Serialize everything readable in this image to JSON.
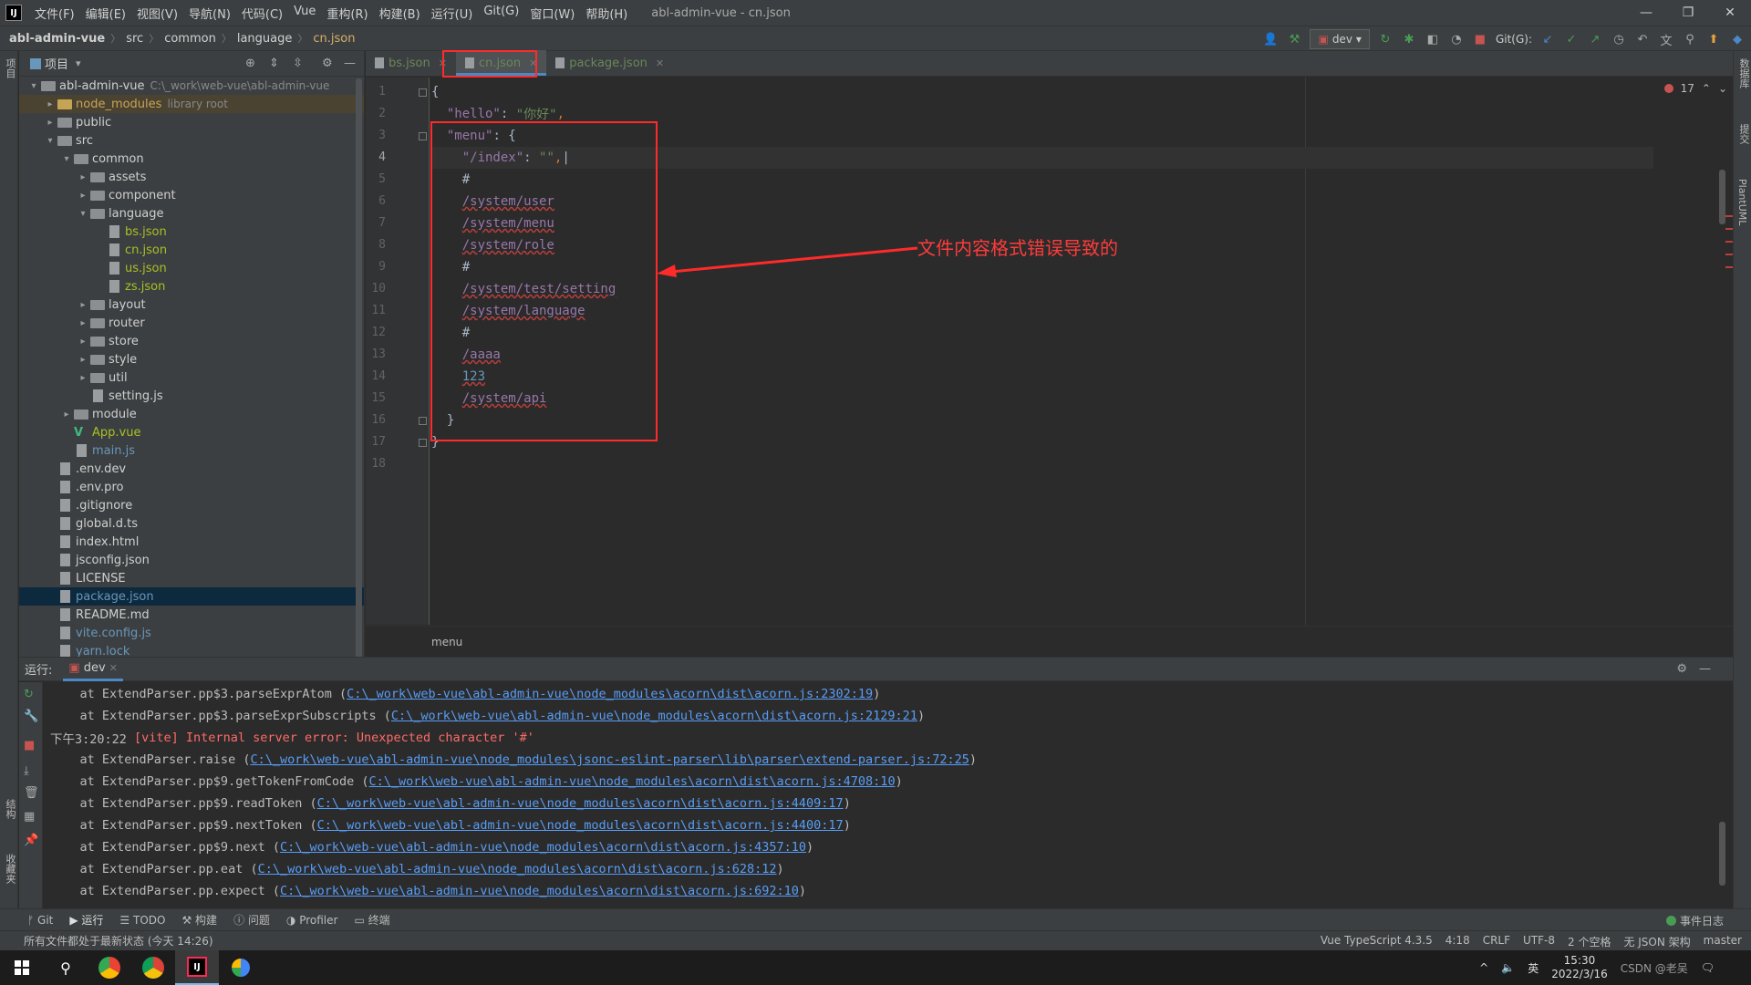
{
  "window": {
    "title": "abl-admin-vue - cn.json",
    "menu": [
      "文件(F)",
      "编辑(E)",
      "视图(V)",
      "导航(N)",
      "代码(C)",
      "Vue",
      "重构(R)",
      "构建(B)",
      "运行(U)",
      "Git(G)",
      "窗口(W)",
      "帮助(H)"
    ]
  },
  "breadcrumb": [
    "abl-admin-vue",
    "src",
    "common",
    "language",
    "cn.json"
  ],
  "toolbar": {
    "run_config": "dev",
    "git_label": "Git(G):"
  },
  "left_stripe": {
    "project": "项目",
    "structure": "结构",
    "favorites": "收藏夹"
  },
  "right_stripe": {
    "database": "数据库",
    "commit": "提交",
    "plantuml": "PlantUML"
  },
  "project": {
    "title": "项目",
    "tree": [
      {
        "name": "abl-admin-vue",
        "extra": "C:\\_work\\web-vue\\abl-admin-vue",
        "level": 0,
        "arrow": "▾",
        "type": "folder"
      },
      {
        "name": "node_modules",
        "extra": "library root",
        "level": 1,
        "arrow": "▸",
        "type": "folder-orange"
      },
      {
        "name": "public",
        "level": 1,
        "arrow": "▸",
        "type": "folder"
      },
      {
        "name": "src",
        "level": 1,
        "arrow": "▾",
        "type": "folder"
      },
      {
        "name": "common",
        "level": 2,
        "arrow": "▾",
        "type": "folder"
      },
      {
        "name": "assets",
        "level": 3,
        "arrow": "▸",
        "type": "folder"
      },
      {
        "name": "component",
        "level": 3,
        "arrow": "▸",
        "type": "folder"
      },
      {
        "name": "language",
        "level": 3,
        "arrow": "▾",
        "type": "folder"
      },
      {
        "name": "bs.json",
        "level": 4,
        "arrow": "",
        "type": "json"
      },
      {
        "name": "cn.json",
        "level": 4,
        "arrow": "",
        "type": "json"
      },
      {
        "name": "us.json",
        "level": 4,
        "arrow": "",
        "type": "json"
      },
      {
        "name": "zs.json",
        "level": 4,
        "arrow": "",
        "type": "json"
      },
      {
        "name": "layout",
        "level": 3,
        "arrow": "▸",
        "type": "folder"
      },
      {
        "name": "router",
        "level": 3,
        "arrow": "▸",
        "type": "folder"
      },
      {
        "name": "store",
        "level": 3,
        "arrow": "▸",
        "type": "folder"
      },
      {
        "name": "style",
        "level": 3,
        "arrow": "▸",
        "type": "folder"
      },
      {
        "name": "util",
        "level": 3,
        "arrow": "▸",
        "type": "folder"
      },
      {
        "name": "setting.js",
        "level": 3,
        "arrow": "",
        "type": "file"
      },
      {
        "name": "module",
        "level": 2,
        "arrow": "▸",
        "type": "folder"
      },
      {
        "name": "App.vue",
        "level": 2,
        "arrow": "",
        "type": "vue"
      },
      {
        "name": "main.js",
        "level": 2,
        "arrow": "",
        "type": "file-blue"
      },
      {
        "name": ".env.dev",
        "level": 1,
        "arrow": "",
        "type": "file"
      },
      {
        "name": ".env.pro",
        "level": 1,
        "arrow": "",
        "type": "file"
      },
      {
        "name": ".gitignore",
        "level": 1,
        "arrow": "",
        "type": "file"
      },
      {
        "name": "global.d.ts",
        "level": 1,
        "arrow": "",
        "type": "file"
      },
      {
        "name": "index.html",
        "level": 1,
        "arrow": "",
        "type": "file"
      },
      {
        "name": "jsconfig.json",
        "level": 1,
        "arrow": "",
        "type": "file"
      },
      {
        "name": "LICENSE",
        "level": 1,
        "arrow": "",
        "type": "file"
      },
      {
        "name": "package.json",
        "level": 1,
        "arrow": "",
        "type": "file-blue",
        "selected": true
      },
      {
        "name": "README.md",
        "level": 1,
        "arrow": "",
        "type": "file"
      },
      {
        "name": "vite.config.js",
        "level": 1,
        "arrow": "",
        "type": "file-blue"
      },
      {
        "name": "yarn.lock",
        "level": 1,
        "arrow": "",
        "type": "file-blue"
      }
    ]
  },
  "editor": {
    "tabs": [
      {
        "label": "bs.json",
        "active": false
      },
      {
        "label": "cn.json",
        "active": true
      },
      {
        "label": "package.json",
        "active": false
      }
    ],
    "error_count": "17",
    "lines": [
      [
        {
          "t": "{",
          "c": ""
        }
      ],
      [
        {
          "t": "  ",
          "c": ""
        },
        {
          "t": "\"hello\"",
          "c": "k"
        },
        {
          "t": ": ",
          "c": ""
        },
        {
          "t": "\"你好\"",
          "c": "s"
        },
        {
          "t": ",",
          "c": "p"
        }
      ],
      [
        {
          "t": "  ",
          "c": ""
        },
        {
          "t": "\"menu\"",
          "c": "k"
        },
        {
          "t": ": {",
          "c": ""
        }
      ],
      [
        {
          "t": "    ",
          "c": ""
        },
        {
          "t": "\"/index\"",
          "c": "k"
        },
        {
          "t": ": ",
          "c": ""
        },
        {
          "t": "\"\"",
          "c": "s"
        },
        {
          "t": ",",
          "c": "p"
        },
        {
          "t": "|",
          "c": ""
        }
      ],
      [
        {
          "t": "    ",
          "c": ""
        },
        {
          "t": "#",
          "c": "hash"
        }
      ],
      [
        {
          "t": "    ",
          "c": ""
        },
        {
          "t": "/system/user",
          "c": "err"
        }
      ],
      [
        {
          "t": "    ",
          "c": ""
        },
        {
          "t": "/system/menu",
          "c": "err"
        }
      ],
      [
        {
          "t": "    ",
          "c": ""
        },
        {
          "t": "/system/role",
          "c": "err"
        }
      ],
      [
        {
          "t": "    ",
          "c": ""
        },
        {
          "t": "#",
          "c": "hash"
        }
      ],
      [
        {
          "t": "    ",
          "c": ""
        },
        {
          "t": "/system/test/setting",
          "c": "err"
        }
      ],
      [
        {
          "t": "    ",
          "c": ""
        },
        {
          "t": "/system/language",
          "c": "err"
        }
      ],
      [
        {
          "t": "    ",
          "c": ""
        },
        {
          "t": "#",
          "c": "hash"
        }
      ],
      [
        {
          "t": "    ",
          "c": ""
        },
        {
          "t": "/aaaa",
          "c": "err"
        }
      ],
      [
        {
          "t": "    ",
          "c": ""
        },
        {
          "t": "123",
          "c": "num"
        }
      ],
      [
        {
          "t": "    ",
          "c": ""
        },
        {
          "t": "/system/api",
          "c": "err"
        }
      ],
      [
        {
          "t": "  }",
          "c": ""
        }
      ],
      [
        {
          "t": "}",
          "c": ""
        }
      ],
      [
        {
          "t": "",
          "c": ""
        }
      ]
    ],
    "current_line": 4,
    "bottom_breadcrumb": "menu"
  },
  "annotation": {
    "text": "文件内容格式错误导致的",
    "color": "#ff2a2a"
  },
  "run": {
    "label": "运行:",
    "tab": "dev",
    "console": [
      {
        "pre": "    at ExtendParser.pp$3.parseExprAtom (",
        "link": "C:\\_work\\web-vue\\abl-admin-vue\\node_modules\\acorn\\dist\\acorn.js:2302:19",
        "post": ")"
      },
      {
        "pre": "    at ExtendParser.pp$3.parseExprSubscripts (",
        "link": "C:\\_work\\web-vue\\abl-admin-vue\\node_modules\\acorn\\dist\\acorn.js:2129:21",
        "post": ")"
      },
      {
        "pre": "下午3:20:22 ",
        "red": "[vite] Internal server error: Unexpected character '#'",
        "link": "",
        "post": ""
      },
      {
        "pre": "    at ExtendParser.raise (",
        "link": "C:\\_work\\web-vue\\abl-admin-vue\\node_modules\\jsonc-eslint-parser\\lib\\parser\\extend-parser.js:72:25",
        "post": ")"
      },
      {
        "pre": "    at ExtendParser.pp$9.getTokenFromCode (",
        "link": "C:\\_work\\web-vue\\abl-admin-vue\\node_modules\\acorn\\dist\\acorn.js:4708:10",
        "post": ")"
      },
      {
        "pre": "    at ExtendParser.pp$9.readToken (",
        "link": "C:\\_work\\web-vue\\abl-admin-vue\\node_modules\\acorn\\dist\\acorn.js:4409:17",
        "post": ")"
      },
      {
        "pre": "    at ExtendParser.pp$9.nextToken (",
        "link": "C:\\_work\\web-vue\\abl-admin-vue\\node_modules\\acorn\\dist\\acorn.js:4400:17",
        "post": ")"
      },
      {
        "pre": "    at ExtendParser.pp$9.next (",
        "link": "C:\\_work\\web-vue\\abl-admin-vue\\node_modules\\acorn\\dist\\acorn.js:4357:10",
        "post": ")"
      },
      {
        "pre": "    at ExtendParser.pp.eat (",
        "link": "C:\\_work\\web-vue\\abl-admin-vue\\node_modules\\acorn\\dist\\acorn.js:628:12",
        "post": ")"
      },
      {
        "pre": "    at ExtendParser.pp.expect (",
        "link": "C:\\_work\\web-vue\\abl-admin-vue\\node_modules\\acorn\\dist\\acorn.js:692:10",
        "post": ")"
      }
    ]
  },
  "tool_tabs": [
    "Git",
    "运行",
    "TODO",
    "构建",
    "问题",
    "Profiler",
    "终端"
  ],
  "event_log": "事件日志",
  "status": {
    "left": "所有文件都处于最新状态 (今天 14:26)",
    "items": [
      "Vue TypeScript 4.3.5",
      "4:18",
      "CRLF",
      "UTF-8",
      "2 个空格",
      "无 JSON 架构",
      "master"
    ]
  },
  "taskbar": {
    "ime": "英",
    "time": "15:30",
    "date": "2022/3/16",
    "watermark": "CSDN @老吴"
  },
  "colors": {
    "accent": "#4a88c7",
    "annotation": "#ff2a2a",
    "link": "#589df6",
    "error": "#ff6b68"
  }
}
